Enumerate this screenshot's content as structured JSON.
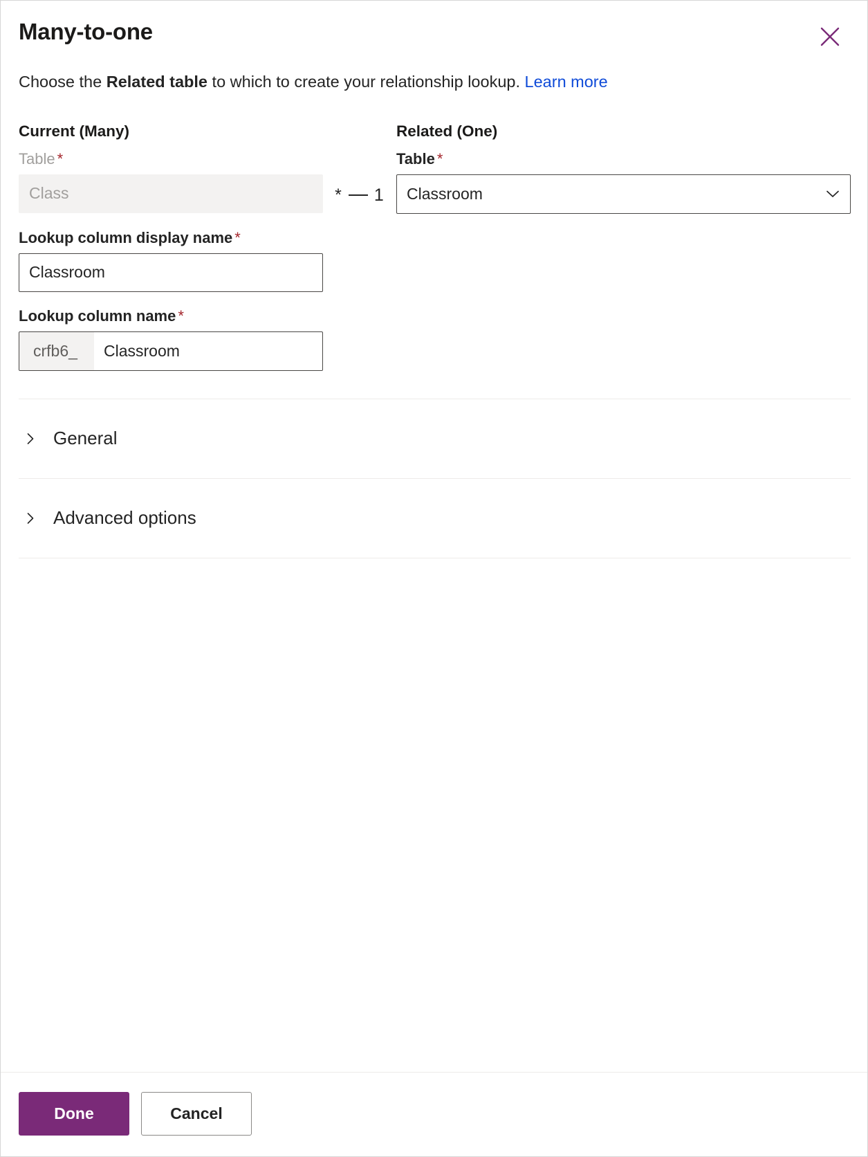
{
  "dialog": {
    "title": "Many-to-one",
    "close_icon": "close-icon"
  },
  "description": {
    "prefix": "Choose the ",
    "strong": "Related table",
    "middle": " to which to create your relationship lookup. ",
    "link": "Learn more"
  },
  "current": {
    "heading": "Current (Many)",
    "table_label": "Table",
    "table_required": "*",
    "table_value": "Class"
  },
  "cardinality": {
    "many": "*",
    "one": "1"
  },
  "related": {
    "heading": "Related (One)",
    "table_label": "Table",
    "table_required": "*",
    "table_value": "Classroom",
    "chevron_icon": "chevron-down-icon"
  },
  "lookup_display_name": {
    "label": "Lookup column display name",
    "required": "*",
    "value": "Classroom"
  },
  "lookup_name": {
    "label": "Lookup column name",
    "required": "*",
    "prefix": "crfb6_",
    "value": "Classroom"
  },
  "accordions": [
    {
      "label": "General",
      "chevron_icon": "chevron-right-icon"
    },
    {
      "label": "Advanced options",
      "chevron_icon": "chevron-right-icon"
    }
  ],
  "footer": {
    "done_label": "Done",
    "cancel_label": "Cancel"
  },
  "colors": {
    "accent": "#7a2a78",
    "link": "#0f4bd8",
    "required": "#a4262c",
    "disabled_bg": "#f3f2f1",
    "border": "#484644",
    "divider": "#edebe9"
  }
}
